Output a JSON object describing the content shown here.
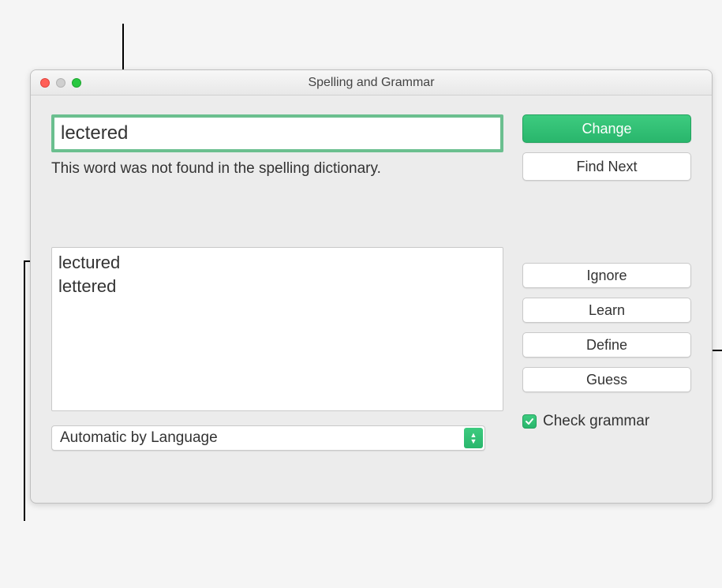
{
  "window": {
    "title": "Spelling and Grammar"
  },
  "input": {
    "value": "lectered"
  },
  "status": "This word was not found in the spelling dictionary.",
  "suggestions": [
    "lectured",
    "lettered"
  ],
  "language": {
    "selected": "Automatic by Language"
  },
  "buttons": {
    "change": "Change",
    "findNext": "Find Next",
    "ignore": "Ignore",
    "learn": "Learn",
    "define": "Define",
    "guess": "Guess"
  },
  "checkGrammar": {
    "label": "Check grammar",
    "checked": true
  },
  "colors": {
    "accent": "#29b66c"
  }
}
